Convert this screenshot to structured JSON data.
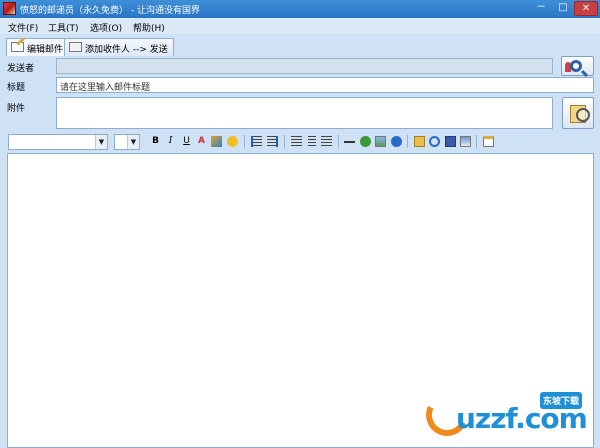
{
  "window": {
    "title": "愤怒的邮递员（永久免费） - 让沟通没有国界",
    "controls": {
      "minimize": "－",
      "maximize": "□",
      "close": "✕"
    }
  },
  "menu": {
    "items": [
      "文件(F)",
      "工具(T)",
      "选项(O)",
      "帮助(H)"
    ]
  },
  "tabs": [
    {
      "label": "编辑邮件",
      "active": true
    },
    {
      "label": "添加收件人 --> 发送",
      "active": false
    }
  ],
  "form": {
    "sender_label": "发送者",
    "sender_value": "",
    "subject_label": "标题",
    "subject_value": "请在这里输入邮件标题",
    "attachment_label": "附件",
    "attachment_value": ""
  },
  "toolbar": {
    "font_name": "",
    "font_size": "",
    "bold": "B",
    "italic": "I",
    "underline": "U",
    "font_color": "A"
  },
  "watermark": {
    "text": "uzzf.com",
    "badge": "东坡下载"
  },
  "colors": {
    "titlebar": "#2a74c4",
    "window_bg": "#cfe2f5",
    "border": "#8eaed0",
    "watermark_blue": "#1f8fd6",
    "watermark_orange": "#f08a1c"
  }
}
